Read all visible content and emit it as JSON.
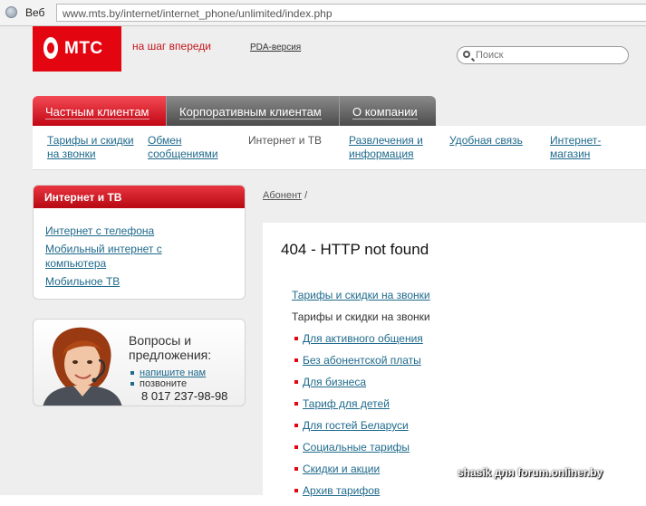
{
  "browser": {
    "label": "Веб",
    "url": "www.mts.by/internet/internet_phone/unlimited/index.php"
  },
  "header": {
    "logo_text": "МТС",
    "slogan": "на шаг впереди",
    "pda_link": "PDA-версия",
    "search_placeholder": "Поиск"
  },
  "nav": {
    "tabs": [
      {
        "label": "Частным клиентам"
      },
      {
        "label": "Корпоративным клиентам"
      },
      {
        "label": "О компании"
      }
    ]
  },
  "subnav": {
    "tariffs": "Тарифы и скидки\nна звонки",
    "messages": "Обмен\nсообщениями",
    "internet_tv": "Интернет и ТВ",
    "entertainment": "Развлечения и\nинформация",
    "convenient": "Удобная связь",
    "shop": "Интернет-\nмагазин"
  },
  "sidebar": {
    "title": "Интернет и ТВ",
    "links": [
      {
        "label": "Интернет с телефона"
      },
      {
        "label": "Мобильный интернет с\nкомпьютера"
      },
      {
        "label": "Мобильное ТВ"
      }
    ]
  },
  "feedback": {
    "title": "Вопросы и\nпредложения:",
    "write_link": "напишите нам",
    "call_label": "позвоните",
    "phone": "8 017 237-98-98"
  },
  "breadcrumb": {
    "link": "Абонент",
    "separator": "/"
  },
  "content": {
    "heading": "404 - HTTP not found",
    "section_link": "Тарифы и скидки на звонки",
    "section_title": "Тарифы и скидки на звонки",
    "items": [
      {
        "label": "Для активного общения"
      },
      {
        "label": "Без абонентской платы"
      },
      {
        "label": "Для бизнеса"
      },
      {
        "label": "Тариф для детей"
      },
      {
        "label": "Для гостей Беларуси"
      },
      {
        "label": "Социальные тарифы"
      },
      {
        "label": "Скидки и акции"
      },
      {
        "label": "Архив тарифов"
      }
    ]
  },
  "watermark": "shasik для forum.onliner.by",
  "colors": {
    "brand_red": "#e30611",
    "link_blue": "#1f6a8c",
    "nav_gray": "#5a5a5a"
  }
}
